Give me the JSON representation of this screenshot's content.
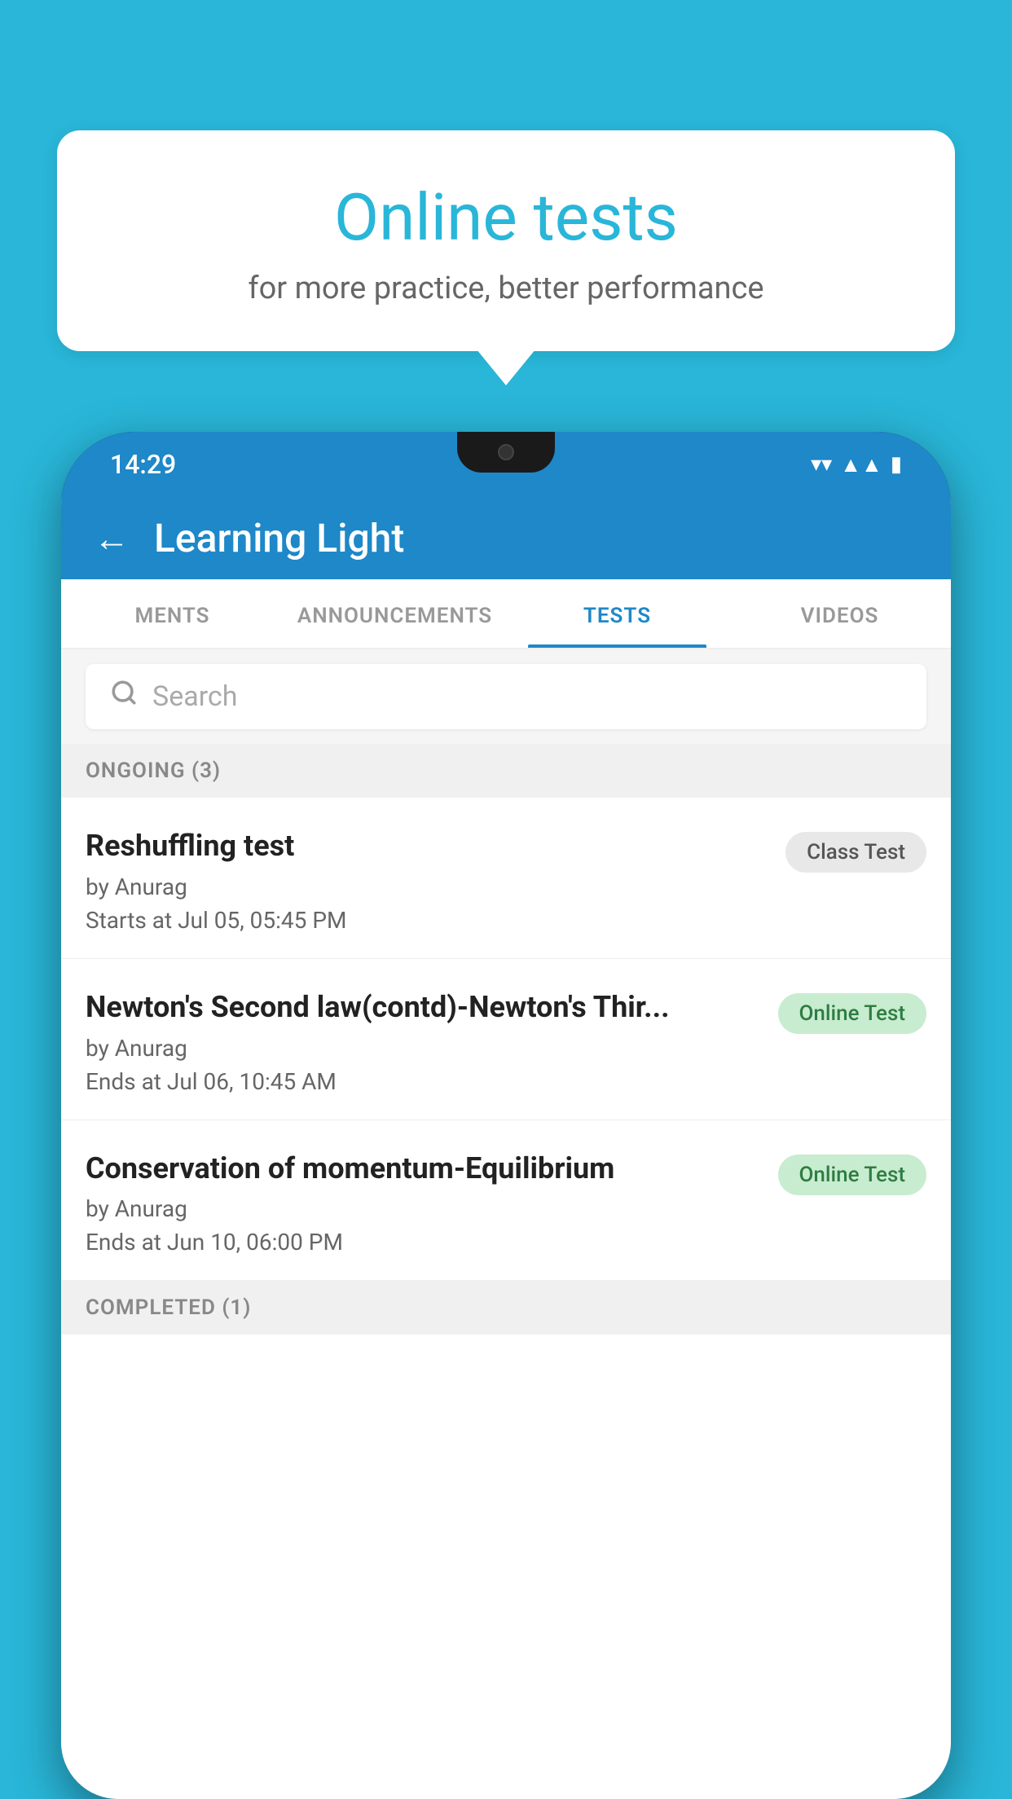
{
  "background_color": "#29B6D8",
  "promo": {
    "title": "Online tests",
    "subtitle": "for more practice, better performance"
  },
  "phone": {
    "status_bar": {
      "time": "14:29"
    },
    "app": {
      "header_title": "Learning Light",
      "back_label": "←",
      "tabs": [
        {
          "label": "MENTS",
          "active": false
        },
        {
          "label": "ANNOUNCEMENTS",
          "active": false
        },
        {
          "label": "TESTS",
          "active": true
        },
        {
          "label": "VIDEOS",
          "active": false
        }
      ],
      "search_placeholder": "Search",
      "sections": [
        {
          "title": "ONGOING (3)",
          "tests": [
            {
              "name": "Reshuffling test",
              "author": "by Anurag",
              "time": "Starts at  Jul 05, 05:45 PM",
              "badge": "Class Test",
              "badge_type": "class"
            },
            {
              "name": "Newton's Second law(contd)-Newton's Thir...",
              "author": "by Anurag",
              "time": "Ends at  Jul 06, 10:45 AM",
              "badge": "Online Test",
              "badge_type": "online"
            },
            {
              "name": "Conservation of momentum-Equilibrium",
              "author": "by Anurag",
              "time": "Ends at  Jun 10, 06:00 PM",
              "badge": "Online Test",
              "badge_type": "online"
            }
          ]
        },
        {
          "title": "COMPLETED (1)",
          "tests": []
        }
      ]
    }
  }
}
